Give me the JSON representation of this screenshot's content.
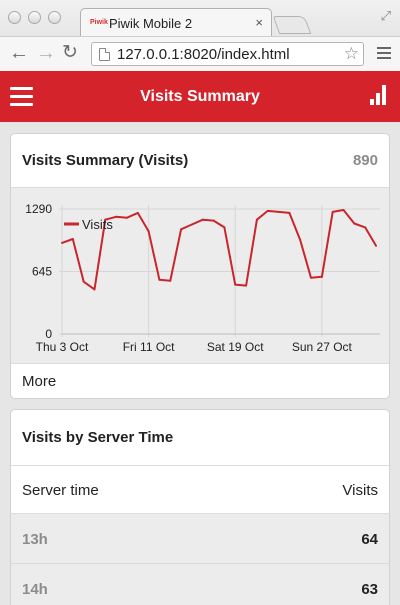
{
  "browser": {
    "tab_favicon": "Piwik",
    "tab_title": "Piwik Mobile 2",
    "tab_close_icon": "×",
    "url": "127.0.0.1:8020/index.html"
  },
  "app": {
    "title": "Visits Summary",
    "accent_color": "#d4232b"
  },
  "visits_card": {
    "title": "Visits Summary (Visits)",
    "total": "890",
    "more_label": "More"
  },
  "chart_data": {
    "type": "line",
    "title": "",
    "xlabel": "",
    "ylabel": "",
    "ylim": [
      0,
      1290
    ],
    "yticks": [
      "0",
      "645",
      "1290"
    ],
    "xticks": [
      {
        "label": "Thu 3 Oct",
        "index": 0
      },
      {
        "label": "Fri 11 Oct",
        "index": 8
      },
      {
        "label": "Sat 19 Oct",
        "index": 16
      },
      {
        "label": "Sun 27 Oct",
        "index": 24
      }
    ],
    "grid": true,
    "legend": "top-left",
    "series": [
      {
        "name": "Visits",
        "color": "#c8262c",
        "values": [
          940,
          980,
          540,
          460,
          1180,
          1210,
          1200,
          1250,
          1060,
          560,
          550,
          1080,
          1130,
          1180,
          1170,
          1100,
          510,
          500,
          1180,
          1270,
          1260,
          1250,
          970,
          580,
          590,
          1260,
          1280,
          1140,
          1100,
          910
        ]
      }
    ]
  },
  "server_time_card": {
    "title": "Visits by Server Time",
    "col_left": "Server time",
    "col_right": "Visits",
    "rows": [
      {
        "label": "13h",
        "value": "64"
      },
      {
        "label": "14h",
        "value": "63"
      }
    ]
  }
}
